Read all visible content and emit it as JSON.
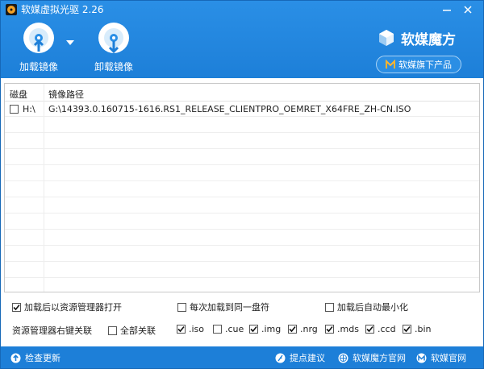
{
  "window": {
    "title": "软媒虚拟光驱 2.26"
  },
  "toolbar": {
    "mount_label": "加载镜像",
    "unmount_label": "卸载镜像"
  },
  "brand": {
    "name": "软媒魔方",
    "products_label": "软媒旗下产品"
  },
  "list": {
    "columns": [
      "磁盘",
      "镜像路径"
    ],
    "rows": [
      {
        "drive": "H:\\",
        "path": "G:\\14393.0.160715-1616.RS1_RELEASE_CLIENTPRO_OEMRET_X64FRE_ZH-CN.ISO",
        "checked": false
      }
    ]
  },
  "options": {
    "open_explorer": {
      "label": "加载后以资源管理器打开",
      "checked": true
    },
    "same_drive": {
      "label": "每次加载到同一盘符",
      "checked": false
    },
    "auto_minimize": {
      "label": "加载后自动最小化",
      "checked": false
    },
    "context_menu_label": "资源管理器右键关联",
    "select_all": {
      "label": "全部关联",
      "checked": false
    },
    "extensions": [
      {
        "label": ".iso",
        "checked": true
      },
      {
        "label": ".cue",
        "checked": false
      },
      {
        "label": ".img",
        "checked": true
      },
      {
        "label": ".nrg",
        "checked": true
      },
      {
        "label": ".mds",
        "checked": true
      },
      {
        "label": ".ccd",
        "checked": true
      },
      {
        "label": ".bin",
        "checked": true
      }
    ]
  },
  "footer": {
    "check_update": "检查更新",
    "feedback": "提点建议",
    "mofang_site": "软媒魔方官网",
    "ruanmei_site": "软媒官网"
  },
  "colors": {
    "accent": "#1d7fd8",
    "header_light": "#2a8fe6",
    "check": "#111111"
  },
  "icons": {
    "app": "disc-app-icon",
    "minimize": "minimize-icon",
    "close": "close-icon",
    "mount": "disc-up-arrow-icon",
    "unmount": "disc-down-arrow-icon",
    "brand": "cube-logo-icon",
    "products": "m-logo-icon",
    "update": "up-arrow-circle-icon",
    "feedback": "feather-icon",
    "site": "globe-icon",
    "ruanmei": "m-logo-icon"
  }
}
